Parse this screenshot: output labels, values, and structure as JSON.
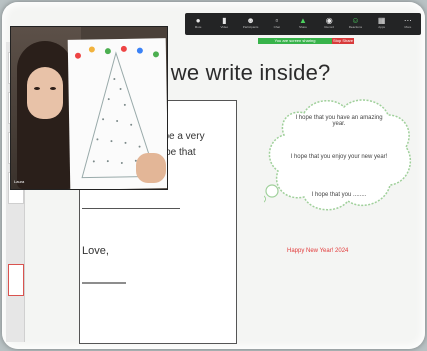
{
  "toolbar": {
    "items": [
      {
        "icon": "microphone-icon",
        "label": "Mute"
      },
      {
        "icon": "video-camera-icon",
        "label": "Video"
      },
      {
        "icon": "participants-icon",
        "label": "Participants"
      },
      {
        "icon": "chat-icon",
        "label": "Chat"
      },
      {
        "icon": "share-screen-icon",
        "label": "Share"
      },
      {
        "icon": "record-icon",
        "label": "Record"
      },
      {
        "icon": "reactions-icon",
        "label": "Reactions"
      },
      {
        "icon": "apps-icon",
        "label": "Apps"
      },
      {
        "icon": "more-icon",
        "label": "More"
      }
    ]
  },
  "status": {
    "recording_label": "You are screen sharing",
    "stop_label": "Stop Share"
  },
  "slide": {
    "title": "d we write inside?",
    "card_line1": "ill be a very",
    "card_line2": "hope that",
    "card_closing": "Love,",
    "cloud_lines": [
      "I hope that you have an amazing year.",
      "I hope that you enjoy your new year!",
      "I hope that you ........"
    ],
    "greeting": "Happy New Year! 2024"
  },
  "webcam": {
    "participant_name": "Laura"
  },
  "colors": {
    "toolbar_bg": "#232425",
    "record_green": "#37b34a",
    "stop_red": "#d83a3a",
    "greeting_red": "#e23a3a"
  }
}
